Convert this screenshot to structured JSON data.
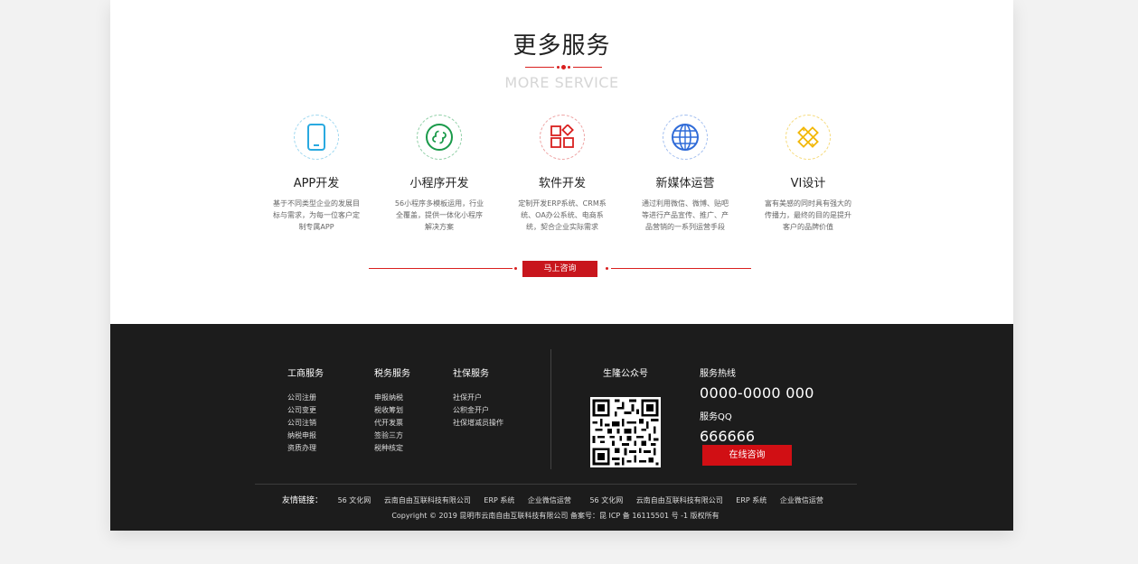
{
  "section": {
    "title": "更多服务",
    "subtitle": "MORE SERVICE",
    "cta_label": "马上咨询"
  },
  "services": [
    {
      "name": "APP开发",
      "icon": "phone-icon",
      "color": "#29a9e0",
      "desc": "基于不同类型企业的发展目标与需求，为每一位客户定制专属APP"
    },
    {
      "name": "小程序开发",
      "icon": "mini-program-icon",
      "color": "#1a9a4a",
      "desc": "56小程序多模板运用，行业全覆盖，提供一体化小程序解决方案"
    },
    {
      "name": "软件开发",
      "icon": "software-icon",
      "color": "#d9201f",
      "desc": "定制开发ERP系统、CRM系统、OA办公系统、电商系统，契合企业实际需求"
    },
    {
      "name": "新媒体运营",
      "icon": "globe-icon",
      "color": "#2f6bd8",
      "desc": "通过利用微信、微博、贴吧等进行产品宣传、推广、产品营销的一系列运营手段"
    },
    {
      "name": "VI设计",
      "icon": "design-tools-icon",
      "color": "#f2b705",
      "desc": "富有美感的同时具有强大的传播力，最终的目的是提升客户的品牌价值"
    }
  ],
  "footer": {
    "columns": [
      {
        "title": "工商服务",
        "items": [
          "公司注册",
          "公司变更",
          "公司注销",
          "纳税申报",
          "资质办理"
        ]
      },
      {
        "title": "税务服务",
        "items": [
          "申报纳税",
          "税收筹划",
          "代开发票",
          "签验三方",
          "税种核定"
        ]
      },
      {
        "title": "社保服务",
        "items": [
          "社保开户",
          "公积金开户",
          "社保增减员操作"
        ]
      }
    ],
    "wechat_title": "生隆公众号",
    "hotline_label": "服务热线",
    "hotline": "0000-0000 000",
    "qq_label": "服务QQ",
    "qq": "666666",
    "online_label": "在线咨询",
    "links_label": "友情链接：",
    "links": [
      "56 文化网",
      "云南自由互联科技有限公司",
      "ERP 系统",
      "企业微信运营",
      "56 文化网",
      "云南自由互联科技有限公司",
      "ERP 系统",
      "企业微信运营"
    ],
    "copyright": "Copyright © 2019 昆明市云南自由互联科技有限公司 备案号：昆 ICP 备 16115501 号 -1 版权所有"
  },
  "colors": {
    "accent": "#c8161d",
    "footer_bg": "#1c1c1c"
  }
}
